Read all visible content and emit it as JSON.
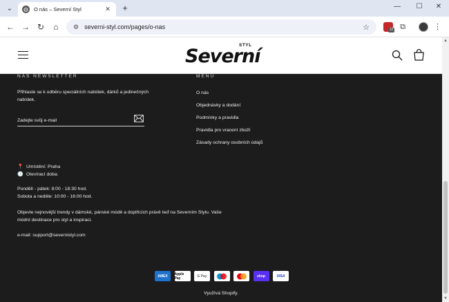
{
  "browser": {
    "tab_title": "O nás – Severní Styl",
    "url": "severni-styl.com/pages/o-nas",
    "extension_badge": "12"
  },
  "header": {
    "logo_main": "Severní",
    "logo_sub": "STYL"
  },
  "footer": {
    "newsletter_title": "NÁŠ NEWSLETTER",
    "newsletter_text": "Přihlaste se k odběru speciálních nabídek, dárků a jedinečných nabídek.",
    "email_placeholder": "Zadejte svůj e-mail",
    "menu_title": "MENU",
    "menu_items": [
      "O nás",
      "Objednávky a dodání",
      "Podmínky a pravidla",
      "Pravidla pro vracení zboží",
      "Zásady ochrany osobních údajů"
    ],
    "location": "Umístění: Praha",
    "opening_label": "Otevírací doba:",
    "hours_weekday": "Pondělí - pátek: 8:00 - 18:30 hod.",
    "hours_weekend": "Sobota a neděle: 10:00 - 16:00 hod.",
    "about_line1": "Objevte nejnovější trendy v dámské, pánské módě a doplňcích právě teď na Severním Stylu. Vaše",
    "about_line2": "módní destinace pro styl a inspiraci.",
    "email_contact": "e-mail: support@severnistyl.com",
    "payments": [
      "AMEX",
      "Apple Pay",
      "G Pay",
      "Maestro",
      "Mastercard",
      "shop",
      "VISA"
    ],
    "powered_by": "Využívá Shopify."
  }
}
